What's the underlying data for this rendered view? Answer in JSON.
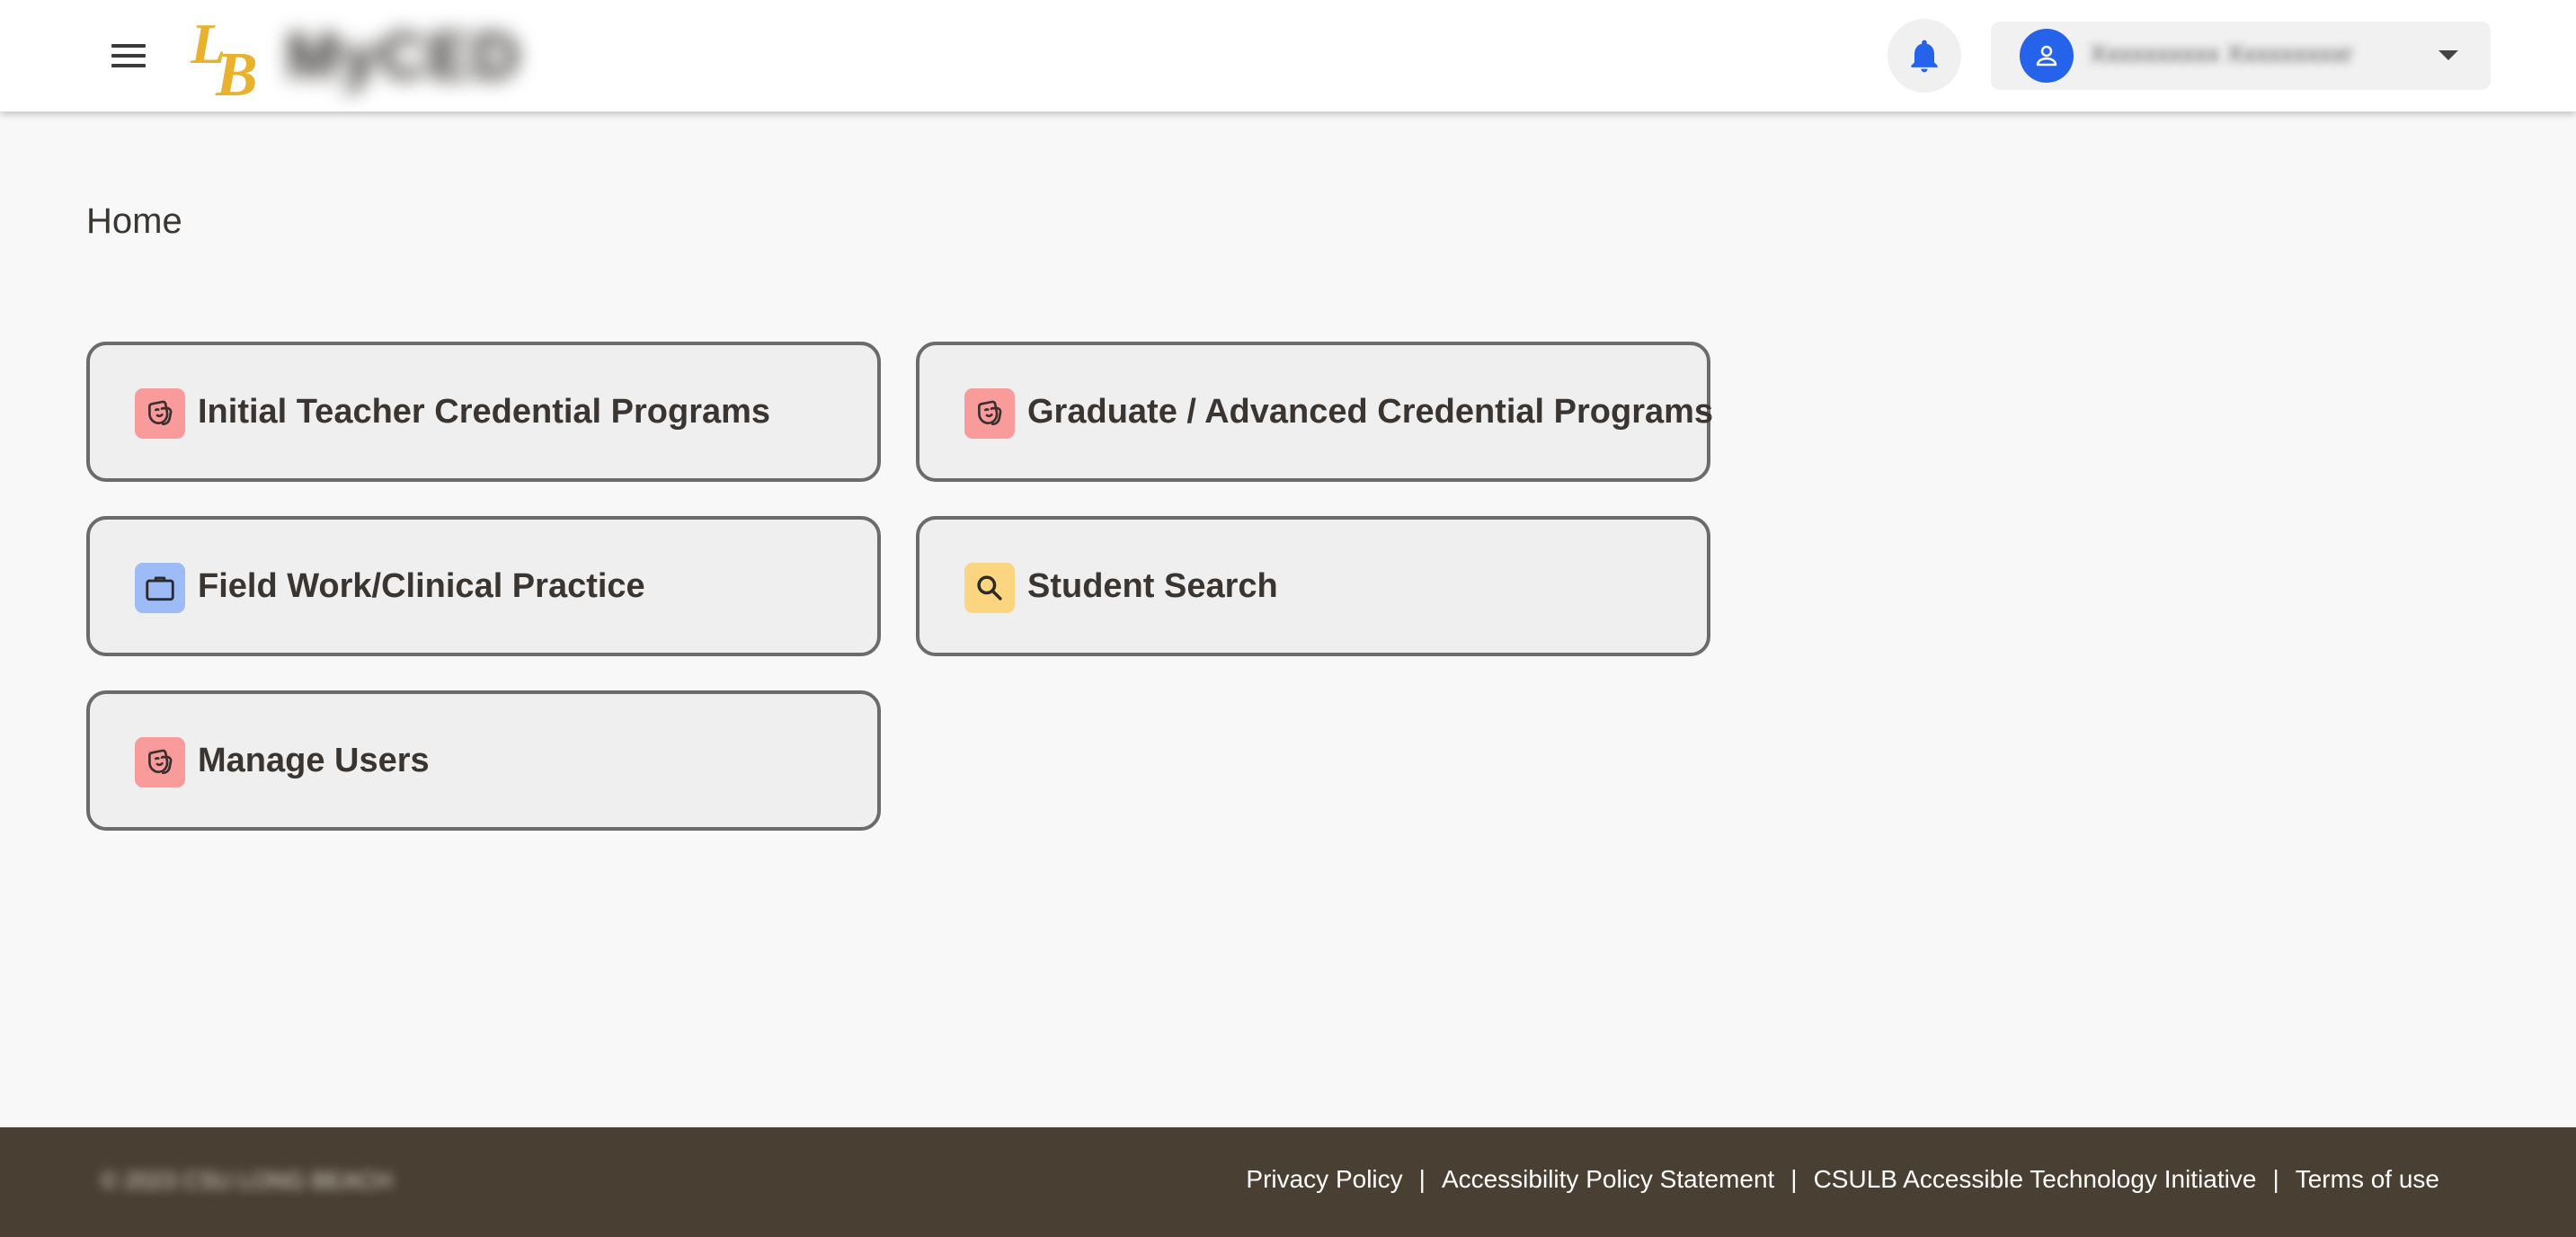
{
  "header": {
    "menu_icon": "hamburger-menu-icon",
    "logo_text": "LB",
    "app_title": "MyCED",
    "notifications_icon": "bell-icon",
    "user": {
      "avatar_icon": "person-icon",
      "name": "Xxxxxxxxxx Xxxxxxxxxr",
      "dropdown_icon": "caret-down-icon"
    }
  },
  "main": {
    "title": "Home",
    "cards": [
      {
        "label": "Initial Teacher Credential Programs",
        "icon": "theater-masks-icon",
        "icon_color": "#f99b9b"
      },
      {
        "label": "Graduate / Advanced Credential Programs",
        "icon": "theater-masks-icon",
        "icon_color": "#f99b9b"
      },
      {
        "label": "Field Work/Clinical Practice",
        "icon": "briefcase-icon",
        "icon_color": "#9dbcf7"
      },
      {
        "label": "Student Search",
        "icon": "search-icon",
        "icon_color": "#fbd580"
      },
      {
        "label": "Manage Users",
        "icon": "theater-masks-icon",
        "icon_color": "#f99b9b"
      }
    ]
  },
  "footer": {
    "copyright": "© 2023 CSU LONG BEACH",
    "links": [
      "Privacy Policy",
      "Accessibility Policy Statement",
      "CSULB Accessible Technology Initiative",
      "Terms of use"
    ],
    "separator": "|"
  },
  "colors": {
    "brand_gold": "#e9b12e",
    "accent_blue": "#2563eb",
    "footer_brown": "#493f32",
    "page_background": "#f8f8f8"
  }
}
